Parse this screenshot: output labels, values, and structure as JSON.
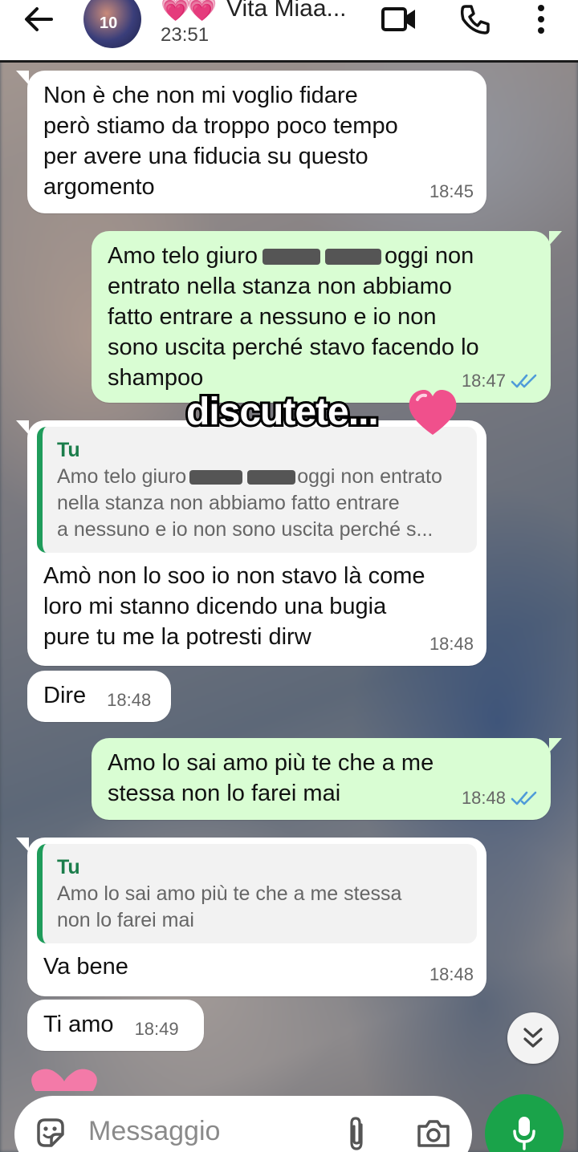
{
  "header": {
    "contact_hearts": "💗💗",
    "contact_name": "Vita Miaa...",
    "last_seen": "23:51",
    "avatar_number": "10"
  },
  "messages": [
    {
      "dir": "in",
      "text": "Non è che non mi voglio fidare\nperò stiamo da troppo poco tempo\nper avere una fiducia su questo\nargomento",
      "time": "18:45"
    },
    {
      "dir": "out",
      "text_a": "Amo telo giuro",
      "text_b": "oggi non",
      "text_c": "entrato nella stanza  non abbiamo\nfatto entrare a nessuno e io non\nsono uscita perché stavo facendo lo\nshampoo",
      "time": "18:47",
      "read": true
    },
    {
      "dir": "in",
      "quote_author": "Tu",
      "quote_a": "Amo telo giuro",
      "quote_b": "oggi non entrato",
      "quote_c": "nella stanza  non abbiamo fatto entrare\na nessuno e io non sono uscita perché s...",
      "text": "Amò non lo soo io non stavo là come\nloro mi stanno dicendo una bugia\npure tu me la potresti dirw",
      "time": "18:48"
    },
    {
      "dir": "in",
      "text": "Dire",
      "time": "18:48"
    },
    {
      "dir": "out",
      "text": "Amo lo sai amo più te che a me\nstessa non lo farei mai",
      "time": "18:48",
      "read": true
    },
    {
      "dir": "in",
      "quote_author": "Tu",
      "quote_text": "Amo lo sai amo più te che a me stessa\nnon lo farei mai",
      "text": "Va bene",
      "time": "18:48"
    },
    {
      "dir": "in",
      "text": "Ti amo",
      "time": "18:49"
    }
  ],
  "overlay": {
    "caption": "discutete...",
    "emoji": "heart"
  },
  "composer": {
    "placeholder": "Messaggio"
  },
  "colors": {
    "outgoing": "#d9fdd3",
    "incoming": "#ffffff",
    "accent": "#1aa34a",
    "read_ticks": "#4f9bd9"
  },
  "icons": [
    "back-arrow-icon",
    "video-call-icon",
    "phone-icon",
    "more-options-icon",
    "sticker-icon",
    "attach-icon",
    "camera-icon",
    "mic-icon",
    "double-chevron-down-icon",
    "double-check-icon"
  ]
}
